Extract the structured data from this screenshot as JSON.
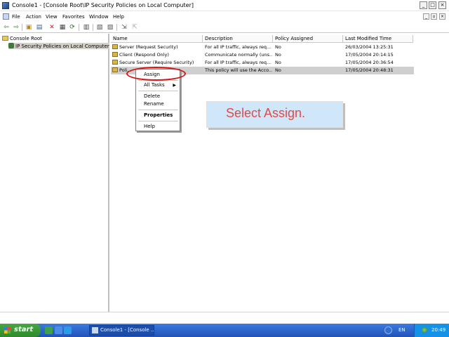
{
  "window": {
    "title": "Console1 - [Console Root\\IP Security Policies on Local Computer]",
    "min": "_",
    "max": "□",
    "close": "×"
  },
  "menu": [
    "File",
    "Action",
    "View",
    "Favorites",
    "Window",
    "Help"
  ],
  "toolbar_icons": [
    "back-icon",
    "forward-icon",
    "up-folder-icon",
    "show-hide-tree-icon",
    "delete-icon",
    "properties-icon",
    "refresh-icon",
    "export-list-icon",
    "help-icon",
    "new-policy-icon",
    "manage-filters-icon",
    "assign-icon",
    "unassign-icon"
  ],
  "tree": {
    "root": "Console Root",
    "child": "IP Security Policies on Local Computer"
  },
  "columns": [
    "Name",
    "Description",
    "Policy Assigned",
    "Last Modified Time"
  ],
  "rows": [
    {
      "name": "Server (Request Security)",
      "description": "For all IP traffic, always req...",
      "assigned": "No",
      "modified": "26/03/2004 13:25:31"
    },
    {
      "name": "Client (Respond Only)",
      "description": "Communicate normally (uns...",
      "assigned": "No",
      "modified": "17/05/2004 20:14:15"
    },
    {
      "name": "Secure Server (Require Security)",
      "description": "For all IP traffic, always req...",
      "assigned": "No",
      "modified": "17/05/2004 20:36:54"
    },
    {
      "name": "Poli...",
      "description": "This policy will use the Acco...",
      "assigned": "No",
      "modified": "17/05/2004 20:48:31"
    }
  ],
  "context_menu": {
    "assign": "Assign",
    "all_tasks": "All Tasks",
    "delete": "Delete",
    "rename": "Rename",
    "properties": "Properties",
    "help": "Help"
  },
  "callout": "Select Assign.",
  "taskbar": {
    "start": "start",
    "task": "Console1 - [Console ...",
    "lang": "EN",
    "clock": "20:49"
  }
}
